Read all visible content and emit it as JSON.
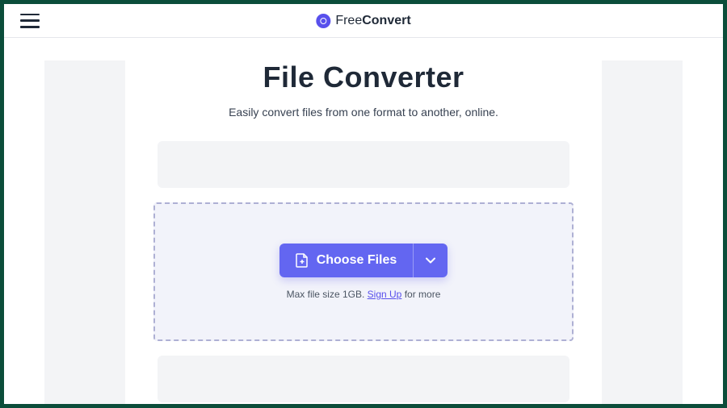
{
  "header": {
    "brand_prefix": "Free",
    "brand_suffix": "Convert"
  },
  "main": {
    "title": "File Converter",
    "subtitle": "Easily convert files from one format to another, online.",
    "choose_files_label": "Choose Files",
    "max_note_prefix": "Max file size 1GB. ",
    "signup_link": "Sign Up",
    "max_note_suffix": " for more"
  }
}
